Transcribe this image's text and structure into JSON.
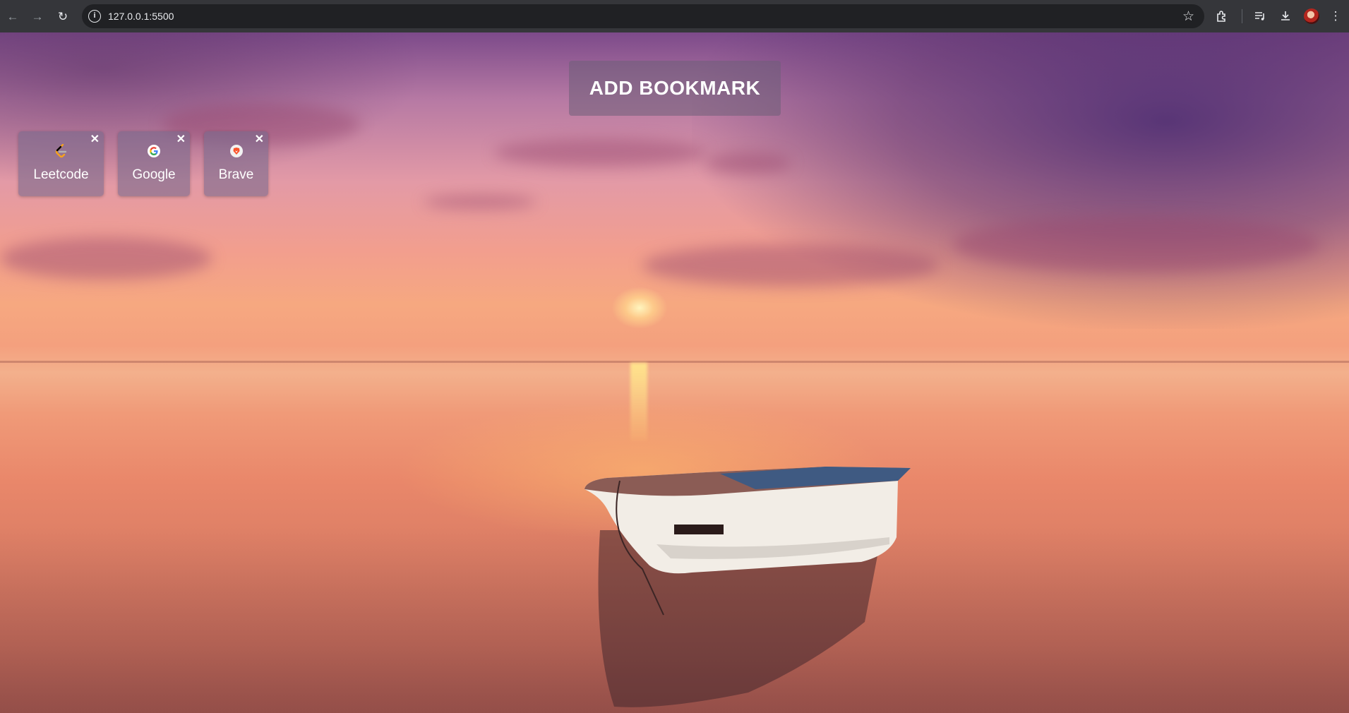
{
  "browser": {
    "url": "127.0.0.1:5500",
    "icons": {
      "back": "back-arrow-icon",
      "forward": "forward-arrow-icon",
      "reload": "reload-icon",
      "site_info": "info-icon",
      "bookmark_star": "star-icon",
      "extensions": "puzzle-icon",
      "media": "media-control-icon",
      "downloads": "download-icon",
      "menu": "kebab-menu-icon"
    }
  },
  "app": {
    "add_button_label": "ADD BOOKMARK",
    "bookmarks": [
      {
        "label": "Leetcode",
        "icon": "leetcode-icon",
        "close": "✕"
      },
      {
        "label": "Google",
        "icon": "google-icon",
        "close": "✕"
      },
      {
        "label": "Brave",
        "icon": "brave-icon",
        "close": "✕"
      }
    ]
  },
  "colors": {
    "chrome_bg": "#35363a",
    "omnibox_bg": "#202124",
    "card_bg": "rgba(120,105,140,0.6)",
    "text": "#ffffff"
  }
}
